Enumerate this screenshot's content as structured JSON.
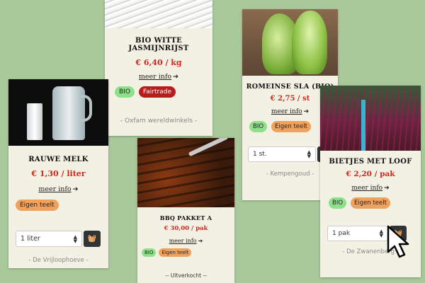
{
  "products": [
    {
      "title": "BIO WITTE JASMIJNRIJST",
      "price": "€ 6,40 / kg",
      "more": "meer info",
      "tags": [
        "BIO",
        "Fairtrade"
      ],
      "seller": "- Oxfam wereldwinkels -"
    },
    {
      "title": "ROMEINSE SLA (BIO)",
      "price": "€ 2,75 / st",
      "more": "meer info",
      "tags": [
        "BIO",
        "Eigen teelt"
      ],
      "qty": "1 st.",
      "seller": "- Kempengoud -"
    },
    {
      "title": "RAUWE MELK",
      "price": "€ 1,30 / liter",
      "more": "meer info",
      "tags": [
        "Eigen teelt"
      ],
      "qty": "1 liter",
      "seller": "- De Vrijloophoeve -"
    },
    {
      "title": "BBQ PAKKET A",
      "price": "€ 30,00 / pak",
      "more": "meer info",
      "tags": [
        "BIO",
        "Eigen teelt"
      ],
      "seller": "-- Uitverkocht --"
    },
    {
      "title": "BIETJES MET LOOF",
      "price": "€ 2,20 / pak",
      "more": "meer info",
      "tags": [
        "BIO",
        "Eigen teelt"
      ],
      "qty": "1 pak",
      "seller": "- De Zwanenberg -"
    }
  ],
  "icons": {
    "arrow": "→",
    "cart": "basket-icon",
    "select": "updown-icon"
  }
}
